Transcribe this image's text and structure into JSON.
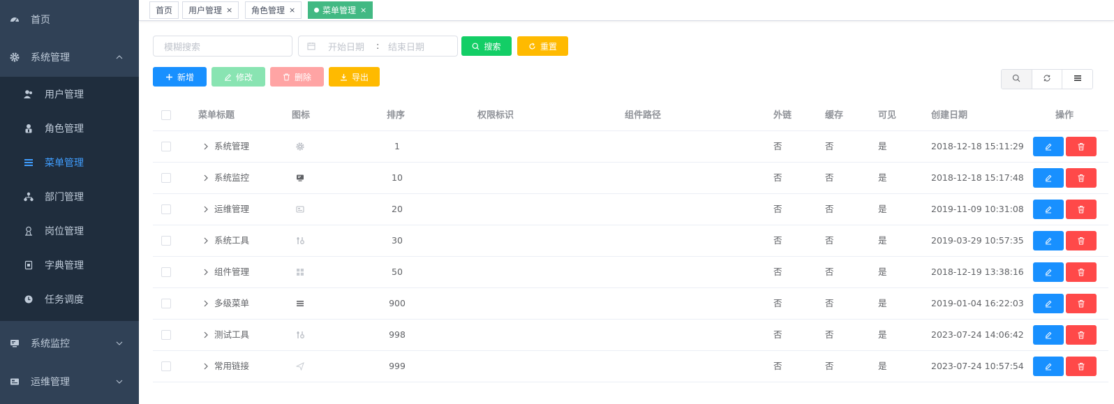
{
  "sidebar": {
    "items": [
      {
        "label": "首页",
        "icon": "dashboard-icon"
      },
      {
        "label": "系统管理",
        "icon": "gear-icon",
        "expanded": true
      },
      {
        "label": "系统监控",
        "icon": "monitor-icon"
      },
      {
        "label": "运维管理",
        "icon": "server-icon"
      }
    ],
    "sub_items": [
      {
        "label": "用户管理",
        "icon": "user-icon"
      },
      {
        "label": "角色管理",
        "icon": "role-icon"
      },
      {
        "label": "菜单管理",
        "icon": "menu-icon",
        "active": true
      },
      {
        "label": "部门管理",
        "icon": "tree-icon"
      },
      {
        "label": "岗位管理",
        "icon": "post-icon"
      },
      {
        "label": "字典管理",
        "icon": "dict-icon"
      },
      {
        "label": "任务调度",
        "icon": "clock-icon"
      }
    ]
  },
  "tags": [
    {
      "label": "首页",
      "closable": false
    },
    {
      "label": "用户管理",
      "closable": true,
      "close": "×"
    },
    {
      "label": "角色管理",
      "closable": true,
      "close": "×"
    },
    {
      "label": "菜单管理",
      "closable": true,
      "close": "×",
      "active": true
    }
  ],
  "search": {
    "placeholder": "模糊搜索",
    "start_date": "开始日期",
    "date_sep": ":",
    "end_date": "结束日期",
    "search_label": "搜索",
    "reset_label": "重置"
  },
  "toolbar": {
    "add_label": "新增",
    "edit_label": "修改",
    "delete_label": "删除",
    "export_label": "导出"
  },
  "table": {
    "headers": {
      "title": "菜单标题",
      "icon": "图标",
      "sort": "排序",
      "permission": "权限标识",
      "component": "组件路径",
      "iframe": "外链",
      "cache": "缓存",
      "hidden": "可见",
      "created": "创建日期",
      "actions": "操作"
    },
    "rows": [
      {
        "title": "系统管理",
        "icon": "gear-icon",
        "sort": "1",
        "iframe": "否",
        "cache": "否",
        "visible": "是",
        "created": "2018-12-18 15:11:29"
      },
      {
        "title": "系统监控",
        "icon": "monitor-icon",
        "sort": "10",
        "iframe": "否",
        "cache": "否",
        "visible": "是",
        "created": "2018-12-18 15:17:48"
      },
      {
        "title": "运维管理",
        "icon": "server-icon",
        "sort": "20",
        "iframe": "否",
        "cache": "否",
        "visible": "是",
        "created": "2019-11-09 10:31:08"
      },
      {
        "title": "系统工具",
        "icon": "tools-icon",
        "sort": "30",
        "iframe": "否",
        "cache": "否",
        "visible": "是",
        "created": "2019-03-29 10:57:35"
      },
      {
        "title": "组件管理",
        "icon": "grid-icon",
        "sort": "50",
        "iframe": "否",
        "cache": "否",
        "visible": "是",
        "created": "2018-12-19 13:38:16"
      },
      {
        "title": "多级菜单",
        "icon": "menu-icon",
        "sort": "900",
        "iframe": "否",
        "cache": "否",
        "visible": "是",
        "created": "2019-01-04 16:22:03"
      },
      {
        "title": "测试工具",
        "icon": "tools-icon",
        "sort": "998",
        "iframe": "否",
        "cache": "否",
        "visible": "是",
        "created": "2023-07-24 14:06:42"
      },
      {
        "title": "常用链接",
        "icon": "send-icon",
        "sort": "999",
        "iframe": "否",
        "cache": "否",
        "visible": "是",
        "created": "2023-07-24 10:57:54"
      }
    ]
  },
  "colors": {
    "sidebar_bg": "#304156",
    "submenu_bg": "#1f2d3d",
    "active_text": "#409eff",
    "tag_active": "#42b983",
    "primary": "#1890ff",
    "success": "#13ce66",
    "warning": "#ffba00",
    "danger": "#ff4949"
  }
}
